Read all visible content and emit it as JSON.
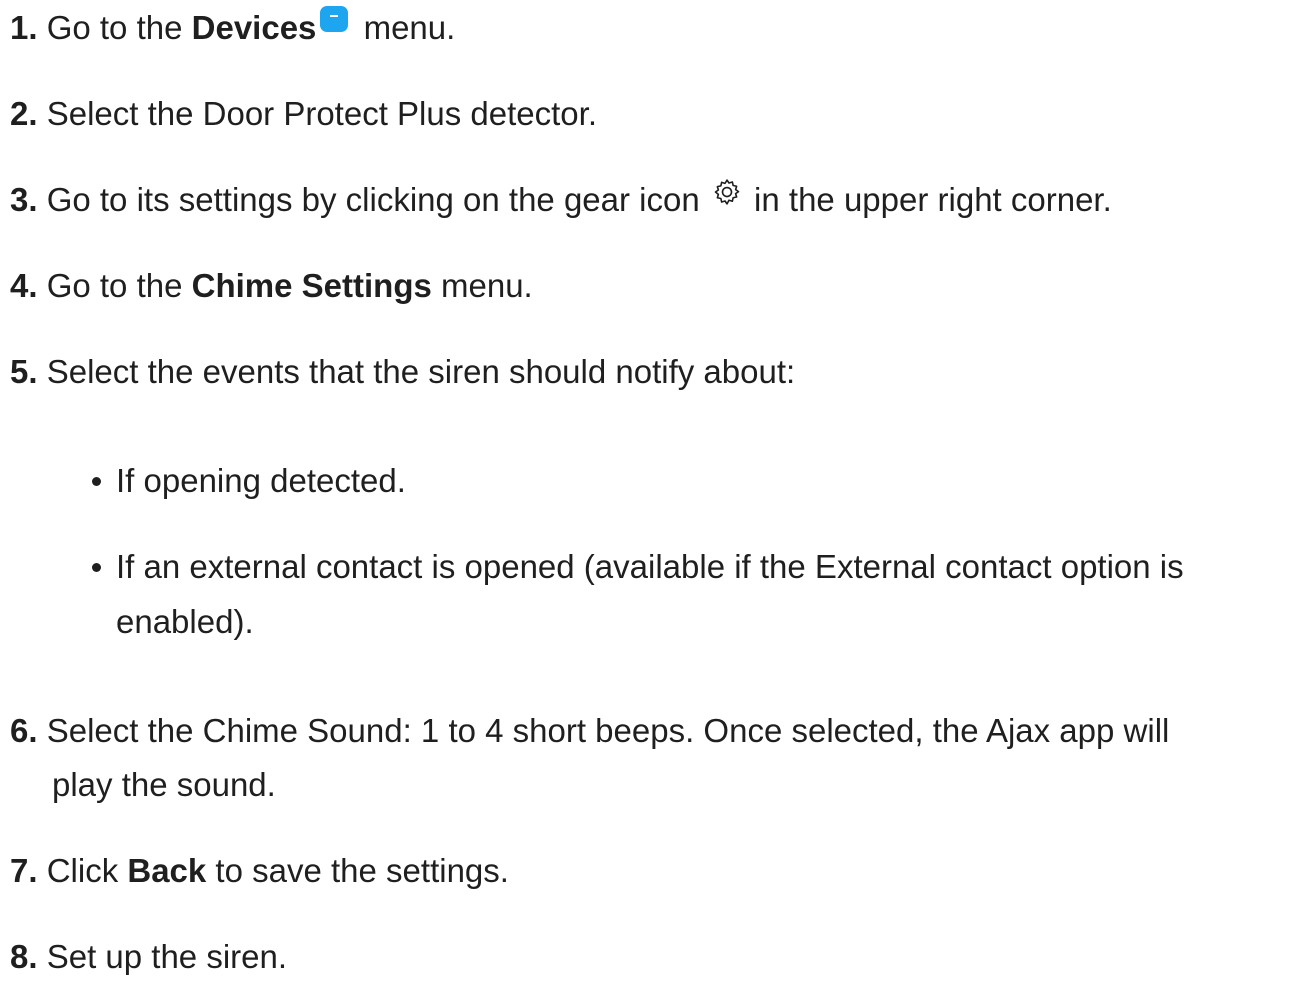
{
  "steps": [
    {
      "num": "1.",
      "pre": "Go to the ",
      "bold": "Devices",
      "post": " menu.",
      "icon": "devices-icon"
    },
    {
      "num": "2.",
      "text": "Select the Door Protect Plus detector."
    },
    {
      "num": "3.",
      "pre": "Go to its settings by clicking on the gear icon ",
      "post": " in the upper right corner.",
      "icon": "gear-icon"
    },
    {
      "num": "4.",
      "pre": "Go to the ",
      "bold": "Chime Settings",
      "post": " menu."
    },
    {
      "num": "5.",
      "text": "Select the events that the siren should notify about:"
    },
    {
      "num": "6.",
      "text": "Select the Chime Sound: 1 to 4 short beeps. Once selected, the Ajax app will",
      "text2": "play the sound."
    },
    {
      "num": "7.",
      "pre": "Click ",
      "bold": "Back",
      "post": " to save the settings."
    },
    {
      "num": "8.",
      "text": "Set up the siren."
    }
  ],
  "bullets": [
    {
      "text": "If opening detected."
    },
    {
      "text": "If an external contact is opened (available if the External contact option is",
      "text2": "enabled)."
    }
  ],
  "colors": {
    "accent": "#1ea5f0",
    "text": "#1f1f1f"
  }
}
